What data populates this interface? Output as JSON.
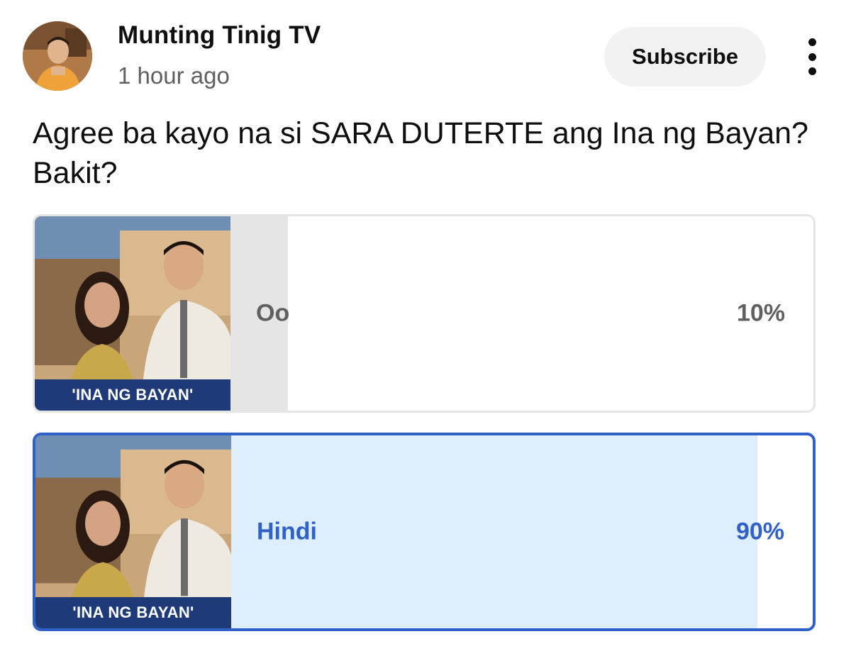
{
  "post": {
    "channel_name": "Munting Tinig TV",
    "timestamp": "1 hour ago",
    "subscribe_label": "Subscribe",
    "question": "Agree ba kayo na si SARA DUTERTE ang Ina ng Bayan? Bakit?"
  },
  "poll": {
    "options": [
      {
        "label": "Oo",
        "percent_label": "10%",
        "percent": 10,
        "selected": false,
        "thumbnail_caption": "'INA NG BAYAN'"
      },
      {
        "label": "Hindi",
        "percent_label": "90%",
        "percent": 90,
        "selected": true,
        "thumbnail_caption": "'INA NG BAYAN'"
      }
    ]
  },
  "icons": {
    "more": "more-vert-icon",
    "avatar": "channel-avatar"
  },
  "colors": {
    "selected_accent": "#2f61c7",
    "selected_fill": "#deeefc",
    "unselected_fill": "#e5e5e5",
    "secondary_text": "#606060",
    "subscribe_bg": "#f2f2f2"
  }
}
